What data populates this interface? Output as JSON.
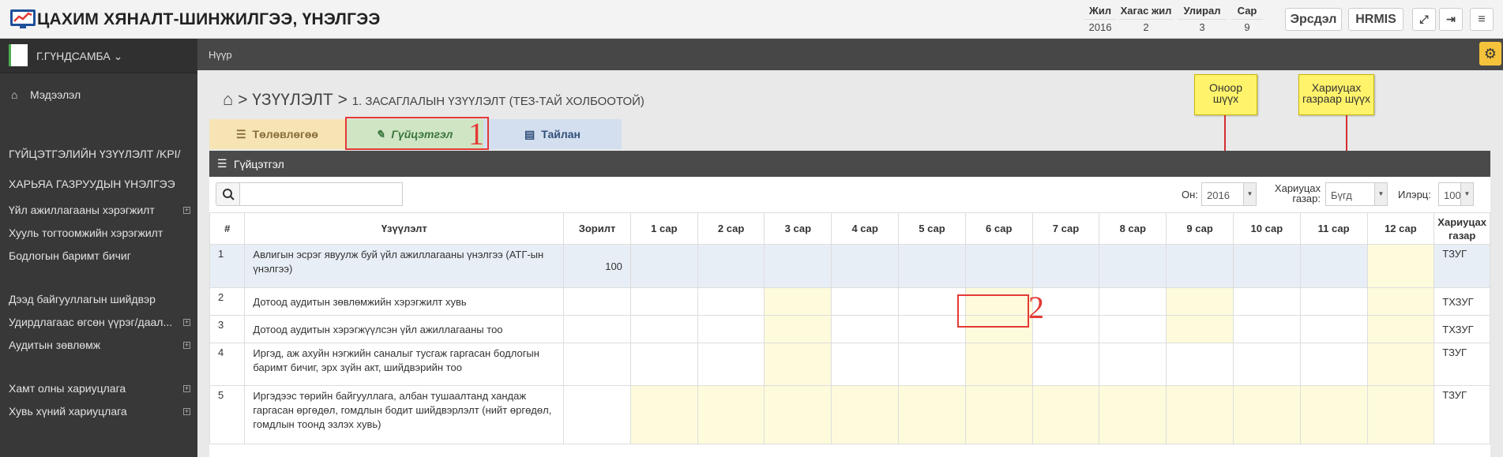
{
  "header": {
    "app_title": "ЦАХИМ ХЯНАЛТ-ШИНЖИЛГЭЭ, ҮНЭЛГЭЭ",
    "period": [
      {
        "label": "Жил",
        "value": "2016"
      },
      {
        "label": "Хагас жил",
        "value": "2"
      },
      {
        "label": "Улирал",
        "value": "3"
      },
      {
        "label": "Сар",
        "value": "9"
      }
    ],
    "buttons": {
      "ersdel": "Эрсдэл",
      "hrmis": "HRMIS"
    }
  },
  "sidebar": {
    "user_name": "Г.ГҮНДСАМБА",
    "items": [
      {
        "label": "Мэдээлэл"
      },
      {
        "label": "ГҮЙЦЭТГЭЛИЙН ҮЗҮҮЛЭЛТ /KPI/"
      },
      {
        "label": "ХАРЬЯА ГАЗРУУДЫН ҮНЭЛГЭЭ"
      },
      {
        "label": "Үйл ажиллагааны хэрэгжилт"
      },
      {
        "label": "Хууль тогтоомжийн хэрэгжилт"
      },
      {
        "label": "Бодлогын баримт бичиг"
      },
      {
        "label": "Дээд байгууллагын шийдвэр"
      },
      {
        "label": "Удирдлагаас өгсөн үүрэг/даал..."
      },
      {
        "label": "Аудитын зөвлөмж"
      },
      {
        "label": "Хамт олны хариуцлага"
      },
      {
        "label": "Хувь хүний хариуцлага"
      }
    ]
  },
  "breadcrumb": {
    "home": "Нүүр",
    "sep": ">",
    "section": "ҮЗҮҮЛЭЛТ",
    "page": "1. ЗАСАГЛАЛЫН ҮЗҮҮЛЭЛТ (ТЕЗ-ТАЙ ХОЛБООТОЙ)"
  },
  "tabs": [
    {
      "label": "Төлөвлөгөө",
      "color": "#f6e4b4"
    },
    {
      "label": "Гүйцэтгэл",
      "color": "#cfe5c4"
    },
    {
      "label": "Тайлан",
      "color": "#d3dfee"
    }
  ],
  "annotations": {
    "marker1": "1",
    "marker2": "2",
    "note_year": "Оноор шүүх",
    "note_dept": "Хариуцах газраар шүүх"
  },
  "panel": {
    "title": "Гүйцэтгэл"
  },
  "filters": {
    "year_label": "Он:",
    "year_value": "2016",
    "dept_label": "Хариуцах газар:",
    "dept_value": "Бүгд",
    "count_label": "Илэрц:",
    "count_value": "100"
  },
  "table": {
    "headers": [
      "#",
      "Үзүүлэлт",
      "Зорилт",
      "1 сар",
      "2 сар",
      "3 сар",
      "4 сар",
      "5 сар",
      "6 сар",
      "7 сар",
      "8 сар",
      "9 сар",
      "10 сар",
      "11 сар",
      "12 сар",
      "Хариуцах газар"
    ],
    "rows": [
      {
        "num": "1",
        "name": "Авлигын эсрэг явуулж буй үйл ажиллагааны үнэлгээ (АТГ-ын үнэлгээ)",
        "target": "100",
        "dept": "ТЗУГ"
      },
      {
        "num": "2",
        "name": "Дотоод аудитын зөвлөмжийн хэрэгжилт хувь",
        "target": "",
        "dept": "ТХЗУГ"
      },
      {
        "num": "3",
        "name": "Дотоод аудитын хэрэгжүүлсэн үйл ажиллагааны тоо",
        "target": "",
        "dept": "ТХЗУГ"
      },
      {
        "num": "4",
        "name": "Иргэд, аж ахуйн нэгжийн саналыг тусгаж гаргасан бодлогын баримт бичиг, эрх зүйн акт, шийдвэрийн тоо",
        "target": "",
        "dept": "ТЗУГ"
      },
      {
        "num": "5",
        "name": "Иргэдээс төрийн байгууллага, албан тушаалтанд хандаж гаргасан өргөдөл, гомдлын бодит шийдвэрлэлт (нийт өргөдөл, гомдлын тоонд эзлэх хувь)",
        "target": "",
        "dept": "ТЗУГ"
      }
    ]
  }
}
